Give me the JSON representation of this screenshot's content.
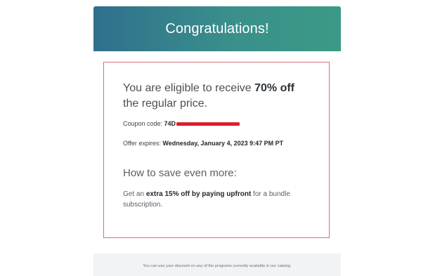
{
  "header": {
    "title": "Congratulations!"
  },
  "offer": {
    "eligible_prefix": "You are eligible to receive ",
    "discount": "70% off",
    "eligible_suffix": "the regular price.",
    "coupon_label": "Coupon code: ",
    "coupon_code_visible": "74D",
    "expires_label": "Offer expires: ",
    "expires_value": "Wednesday, January 4, 2023 9:47 PM PT",
    "save_heading": "How to save even more:",
    "bundle_prefix": "Get an ",
    "bundle_bold": "extra 15% off by paying upfront",
    "bundle_suffix": " for a bundle subscription."
  },
  "footer": {
    "note": "You can use your discount on any of the programs currently available in our catalog."
  },
  "colors": {
    "header_gradient_start": "#2f6f8d",
    "header_gradient_end": "#3b9a86",
    "offer_border": "#d16f7b",
    "redaction": "#d91f2f"
  }
}
